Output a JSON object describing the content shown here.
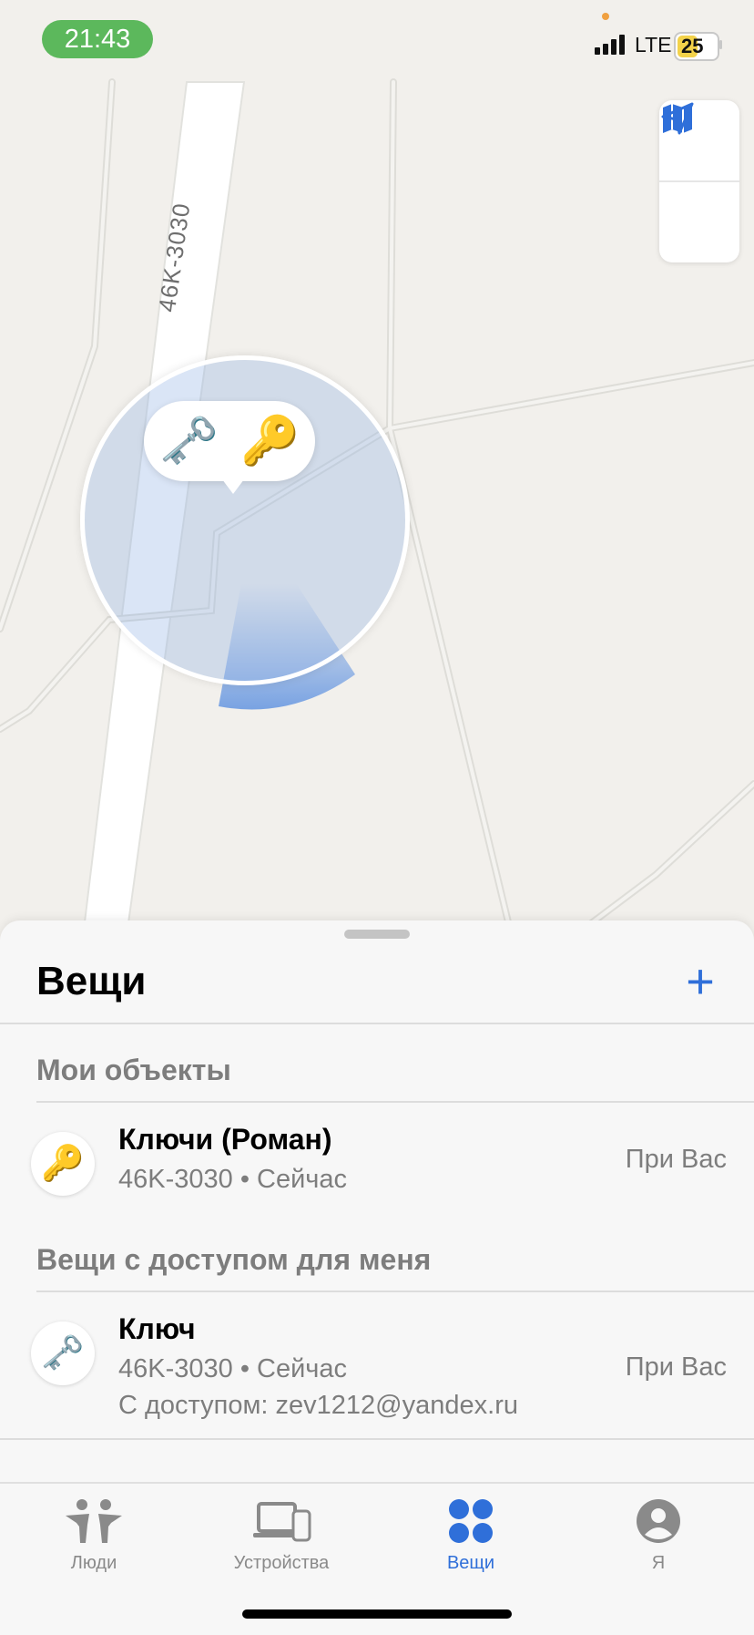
{
  "status_bar": {
    "time": "21:43",
    "network": "LTE",
    "battery": "25"
  },
  "map": {
    "road_label": "46K-3030",
    "controls": {
      "map_mode_icon": "map-icon",
      "location_icon": "location-arrow-icon"
    },
    "callout_items": [
      "old-key-icon",
      "key-icon"
    ]
  },
  "sheet": {
    "title": "Вещи",
    "add_label": "+",
    "sections": [
      {
        "heading": "Мои объекты",
        "items": [
          {
            "name": "Ключи (Роман)",
            "subtitle": "46K-3030 • Сейчас",
            "status": "При Вас",
            "icon": "key-icon"
          }
        ]
      },
      {
        "heading": "Вещи с доступом для меня",
        "items": [
          {
            "name": "Ключ",
            "subtitle": "46K-3030 • Сейчас",
            "shared": "С доступом: zev1212@yandex.ru",
            "status": "При Вас",
            "icon": "old-key-icon"
          }
        ]
      }
    ]
  },
  "tabbar": {
    "tabs": [
      {
        "label": "Люди",
        "icon": "people-icon",
        "active": false
      },
      {
        "label": "Устройства",
        "icon": "devices-icon",
        "active": false
      },
      {
        "label": "Вещи",
        "icon": "items-icon",
        "active": true
      },
      {
        "label": "Я",
        "icon": "me-icon",
        "active": false
      }
    ]
  },
  "colors": {
    "accent": "#2f6fd9",
    "time_pill": "#5cb85c",
    "battery": "#f3d24a"
  }
}
